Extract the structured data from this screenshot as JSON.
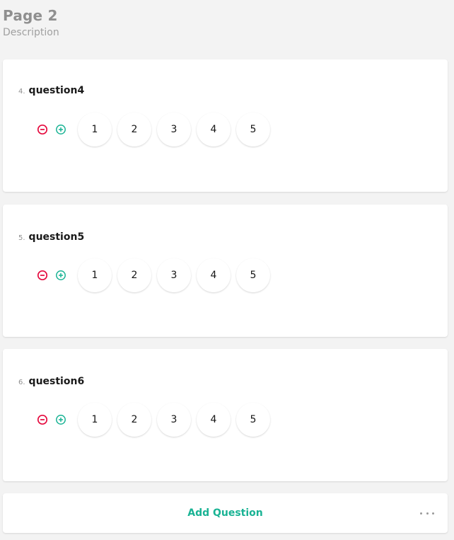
{
  "page": {
    "title": "Page 2",
    "description": "Description"
  },
  "colors": {
    "remove": "#e50a3e",
    "add": "#19b394",
    "accent": "#19b394"
  },
  "icons": {
    "remove": "minus-circle-icon",
    "add": "plus-circle-icon",
    "more": "more-dots-icon"
  },
  "questions": [
    {
      "number": "4.",
      "name": "question4",
      "rates": [
        "1",
        "2",
        "3",
        "4",
        "5"
      ]
    },
    {
      "number": "5.",
      "name": "question5",
      "rates": [
        "1",
        "2",
        "3",
        "4",
        "5"
      ]
    },
    {
      "number": "6.",
      "name": "question6",
      "rates": [
        "1",
        "2",
        "3",
        "4",
        "5"
      ]
    }
  ],
  "footer": {
    "add_question_label": "Add Question"
  }
}
